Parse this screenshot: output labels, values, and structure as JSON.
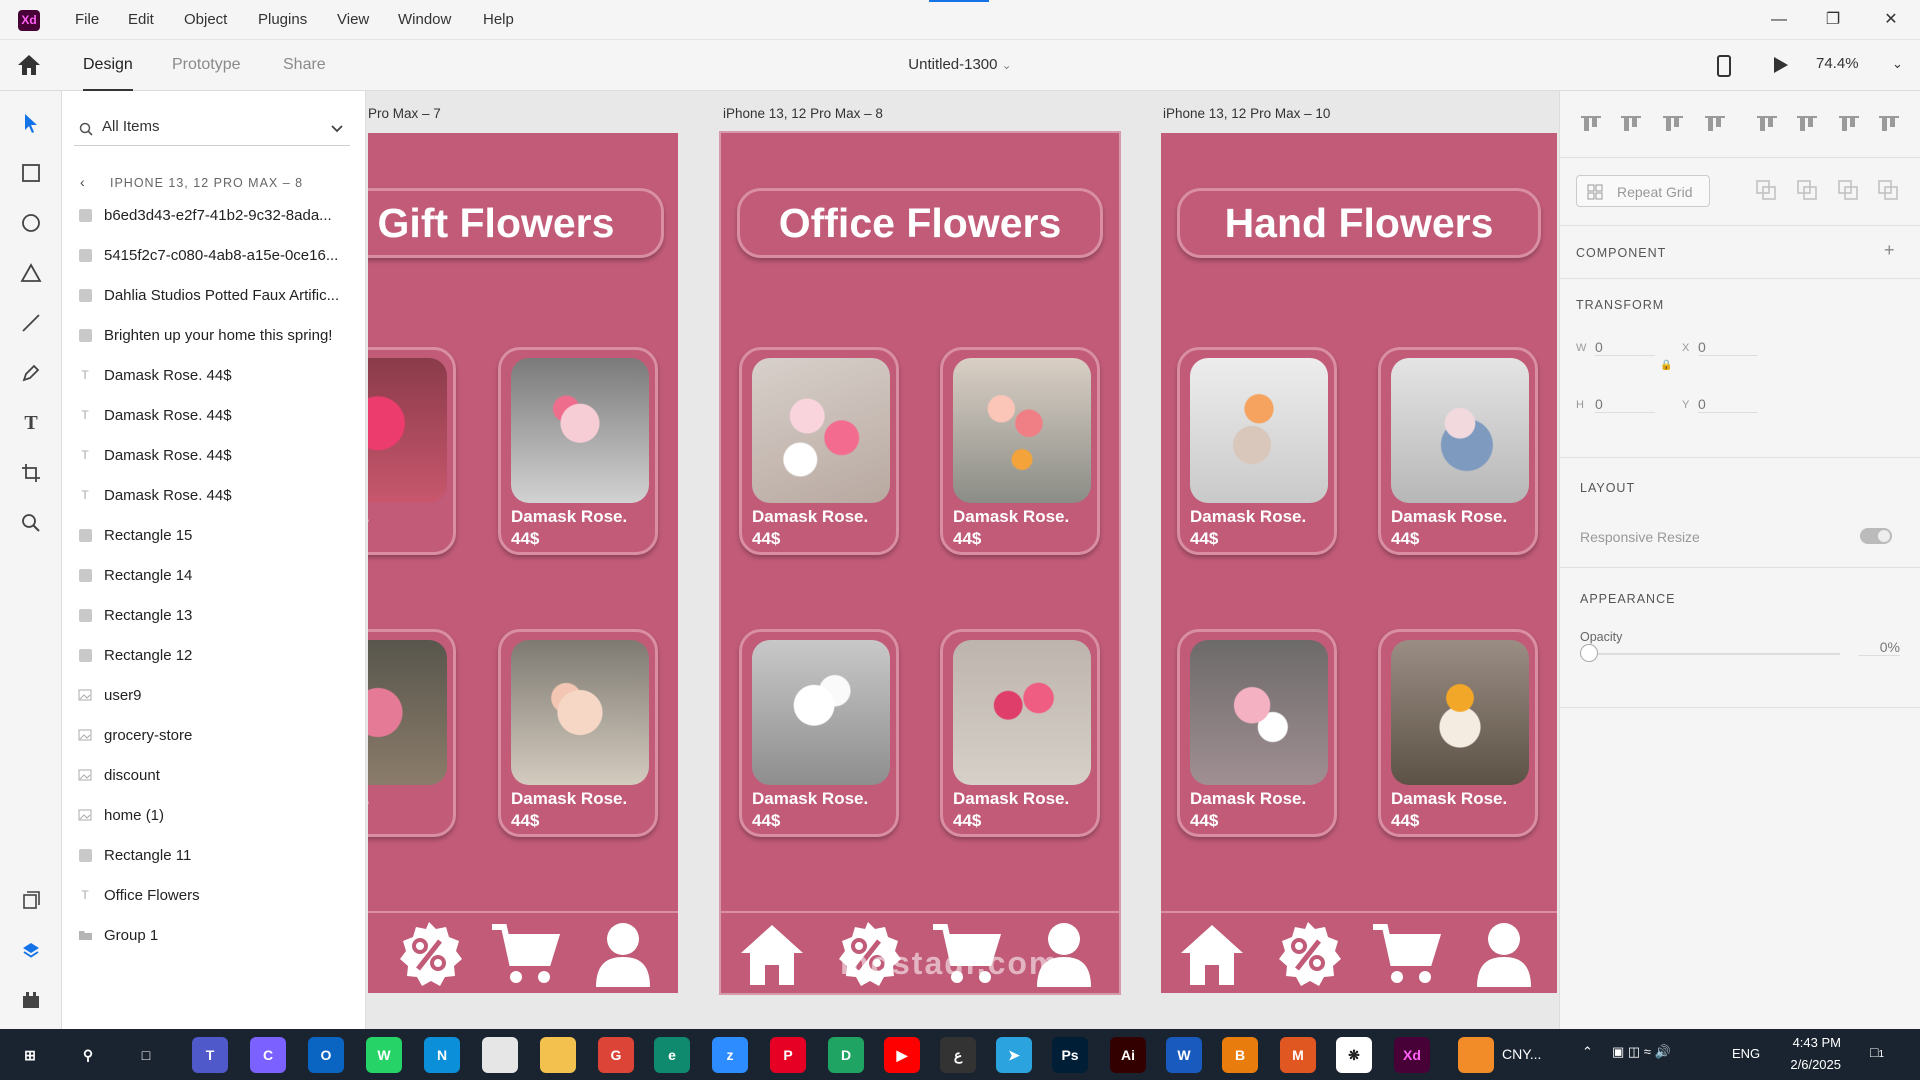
{
  "app": {
    "logo_text": "Xd",
    "document_name": "Untitled-1300",
    "zoom": "74.4%"
  },
  "menu": [
    "File",
    "Edit",
    "Object",
    "Plugins",
    "View",
    "Window",
    "Help"
  ],
  "mode_tabs": [
    "Design",
    "Prototype",
    "Share"
  ],
  "layers_panel": {
    "search_placeholder": "All Items",
    "group_title": "IPHONE 13, 12 PRO MAX – 8",
    "items": [
      {
        "type": "rect",
        "label": "b6ed3d43-e2f7-41b2-9c32-8ada..."
      },
      {
        "type": "rect",
        "label": "5415f2c7-c080-4ab8-a15e-0ce16..."
      },
      {
        "type": "rect",
        "label": "Dahlia Studios Potted Faux Artific..."
      },
      {
        "type": "rect",
        "label": "Brighten up your home this spring!"
      },
      {
        "type": "text",
        "label": "Damask Rose. 44$"
      },
      {
        "type": "text",
        "label": "Damask Rose. 44$"
      },
      {
        "type": "text",
        "label": "Damask Rose. 44$"
      },
      {
        "type": "text",
        "label": "Damask Rose. 44$"
      },
      {
        "type": "rect",
        "label": "Rectangle 15"
      },
      {
        "type": "rect",
        "label": "Rectangle 14"
      },
      {
        "type": "rect",
        "label": "Rectangle 13"
      },
      {
        "type": "rect",
        "label": "Rectangle 12"
      },
      {
        "type": "image",
        "label": "user9"
      },
      {
        "type": "image",
        "label": "grocery-store"
      },
      {
        "type": "image",
        "label": "discount"
      },
      {
        "type": "image",
        "label": "home (1)"
      },
      {
        "type": "rect",
        "label": "Rectangle 11"
      },
      {
        "type": "text",
        "label": "Office Flowers"
      },
      {
        "type": "group",
        "label": "Group 1"
      }
    ]
  },
  "artboards": [
    {
      "label": "Pro Max – 7",
      "title": "Gift Flowers"
    },
    {
      "label": "iPhone 13, 12 Pro Max – 8",
      "title": "Office Flowers"
    },
    {
      "label": "iPhone 13, 12 Pro Max – 10",
      "title": "Hand Flowers"
    }
  ],
  "card": {
    "name": "Damask Rose.",
    "price": "44$",
    "partial_name": "k Rose."
  },
  "properties": {
    "repeat_grid": "Repeat Grid",
    "component": "COMPONENT",
    "transform": "TRANSFORM",
    "w_label": "W",
    "w_value": "0",
    "h_label": "H",
    "h_value": "0",
    "x_label": "X",
    "x_value": "0",
    "y_label": "Y",
    "y_value": "0",
    "layout": "LAYOUT",
    "responsive_resize": "Responsive Resize",
    "appearance": "APPEARANCE",
    "opacity_label": "Opacity",
    "opacity_value": "0%"
  },
  "taskbar": {
    "app_label": "CNY...",
    "language": "ENG",
    "time": "4:43 PM",
    "date": "2/6/2025",
    "notifications": "1"
  },
  "watermark": "mostaql.com",
  "colors": {
    "artboard_bg": "#c15b78",
    "card_border": "#d98ea3",
    "accent": "#1473e6"
  }
}
